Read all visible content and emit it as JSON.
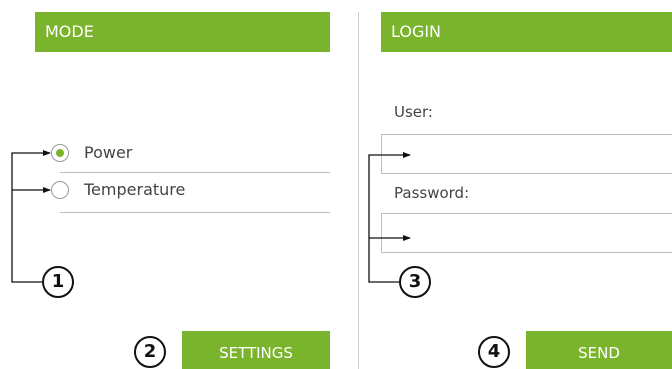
{
  "mode_panel": {
    "title": "MODE",
    "options": [
      {
        "label": "Power",
        "selected": true
      },
      {
        "label": "Temperature",
        "selected": false
      }
    ],
    "settings_button": "SETTINGS",
    "badge_radios": "1",
    "badge_settings": "2"
  },
  "login_panel": {
    "title": "LOGIN",
    "user_label": "User:",
    "password_label": "Password:",
    "user_value": "",
    "password_value": "",
    "send_button": "SEND",
    "badge_fields": "3",
    "badge_send": "4"
  },
  "colors": {
    "accent": "#7ab42c",
    "divider": "#cfcfcf",
    "text": "#444444",
    "annotation": "#111111"
  },
  "icons": {
    "radio_selected": "radio-selected-icon",
    "radio_unselected": "radio-unselected-icon",
    "pointer_arrow": "arrow-right-icon"
  }
}
